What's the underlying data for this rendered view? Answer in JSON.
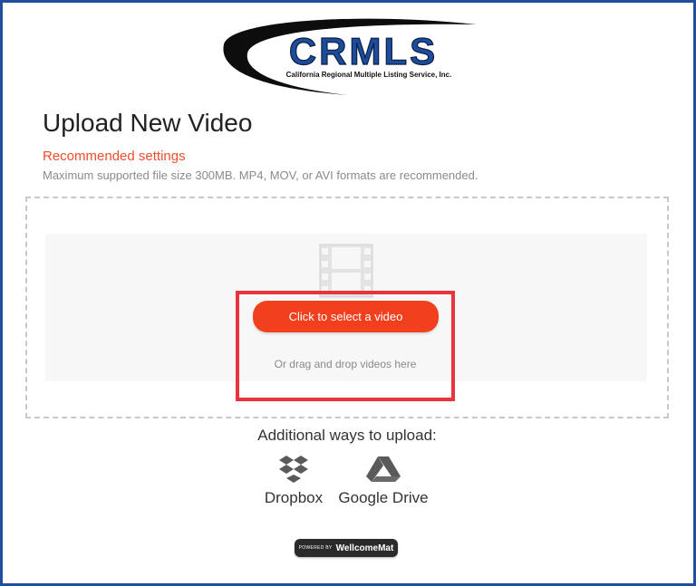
{
  "logo": {
    "name": "CRMLS",
    "tagline": "California Regional Multiple Listing Service, Inc."
  },
  "page": {
    "title": "Upload New Video",
    "recommended_label": "Recommended settings",
    "recommended_desc": "Maximum supported file size 300MB. MP4, MOV, or AVI formats are recommended."
  },
  "upload": {
    "select_button": "Click to select a video",
    "drag_text": "Or drag and drop videos here"
  },
  "additional": {
    "heading": "Additional ways to upload:",
    "services": [
      {
        "label": "Dropbox",
        "icon": "dropbox-icon"
      },
      {
        "label": "Google Drive",
        "icon": "google-drive-icon"
      }
    ]
  },
  "footer": {
    "powered_by": "POWERED BY",
    "brand": "WellcomeMat"
  },
  "colors": {
    "accent": "#f2401f",
    "highlight": "#e8343c",
    "frame": "#1f4f9e",
    "logo_blue": "#1d4c9a"
  }
}
